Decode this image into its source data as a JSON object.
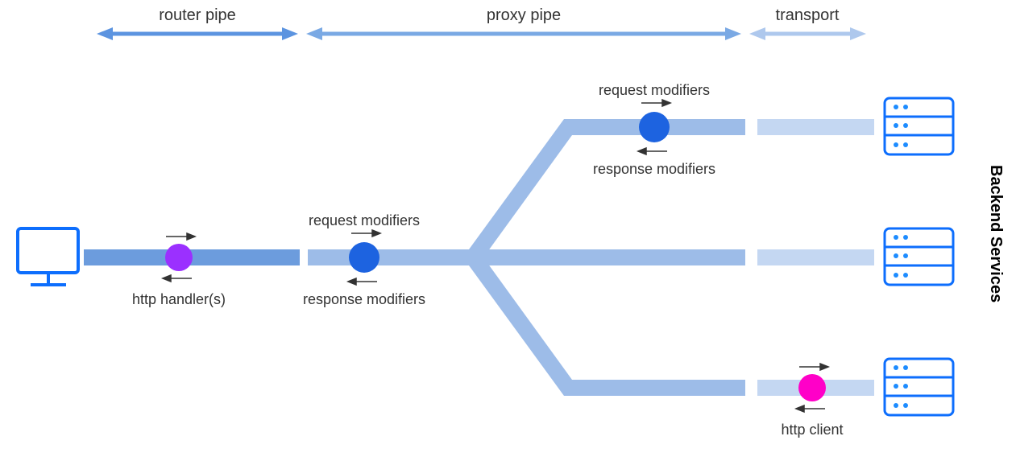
{
  "sections": {
    "router": "router pipe",
    "proxy": "proxy pipe",
    "transport": "transport"
  },
  "nodes": {
    "handler": "http handler(s)",
    "proxy_req": "request modifiers",
    "proxy_resp": "response modifiers",
    "branch_req": "request modifiers",
    "branch_resp": "response modifiers",
    "client": "http client"
  },
  "side_label": "Backend Services",
  "colors": {
    "blue_dark": "#0d6efd",
    "pipe_router": "#6c9cdd",
    "pipe_proxy": "#9dbce8",
    "pipe_transport": "#c4d7f2",
    "dot_purple": "#9b30ff",
    "dot_blue": "#1d63e0",
    "dot_magenta": "#ff00c8",
    "arrow_section": "#5c94e0",
    "arrow_transport": "#aec8ed",
    "svc_dot": "#1d8cff"
  }
}
